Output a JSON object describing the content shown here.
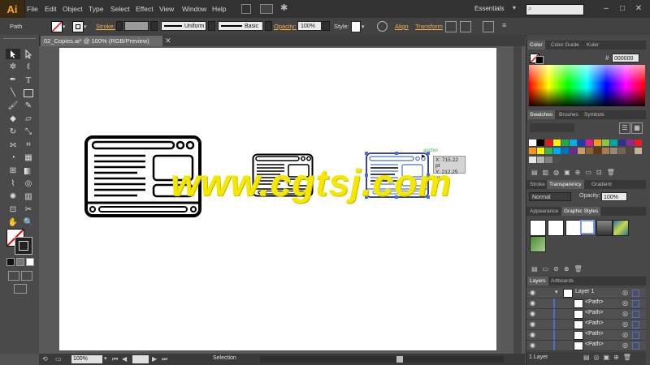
{
  "app": {
    "logo": "Ai",
    "workspace": "Essentials"
  },
  "menu": [
    "File",
    "Edit",
    "Object",
    "Type",
    "Select",
    "Effect",
    "View",
    "Window",
    "Help"
  ],
  "control": {
    "selection_type": "Path",
    "stroke_label": "Stroke:",
    "profile": "Uniform",
    "brush": "Basic",
    "opacity_label": "Opacity:",
    "opacity_value": "100%",
    "style_label": "Style:",
    "align_label": "Align",
    "transform_label": "Transform"
  },
  "document": {
    "tab_title": "02_Copies.ai* @ 100% (RGB/Preview)"
  },
  "canvas": {
    "smart_guide_label": "anchor",
    "readout_x": "X: 715.22 pt",
    "readout_y": "Y: 212.25 pt",
    "watermark": "www.cgtsj.com"
  },
  "panels": {
    "color_tabs": [
      "Color",
      "Color Guide",
      "Kuler"
    ],
    "hex_value": "000000",
    "swatch_tabs": [
      "Swatches",
      "Brushes",
      "Symbols"
    ],
    "stroke_tabs": [
      "Stroke",
      "Transparency",
      "Gradient"
    ],
    "blend_mode": "Normal",
    "transp_opacity_label": "Opacity:",
    "transp_opacity_value": "100%",
    "appearance_tabs": [
      "Appearance",
      "Graphic Styles"
    ],
    "layers_tabs": [
      "Layers",
      "Artboards"
    ],
    "layers": {
      "layer_name": "Layer 1",
      "paths": [
        "<Path>",
        "<Path>",
        "<Path>",
        "<Path>",
        "<Path>",
        "<Path>"
      ],
      "count": "1 Layer"
    }
  },
  "status": {
    "zoom": "100%",
    "tool": "Selection"
  },
  "colors": {
    "accent": "#f7a529",
    "selection": "#4a6fd8",
    "watermark": "#f4e800"
  }
}
